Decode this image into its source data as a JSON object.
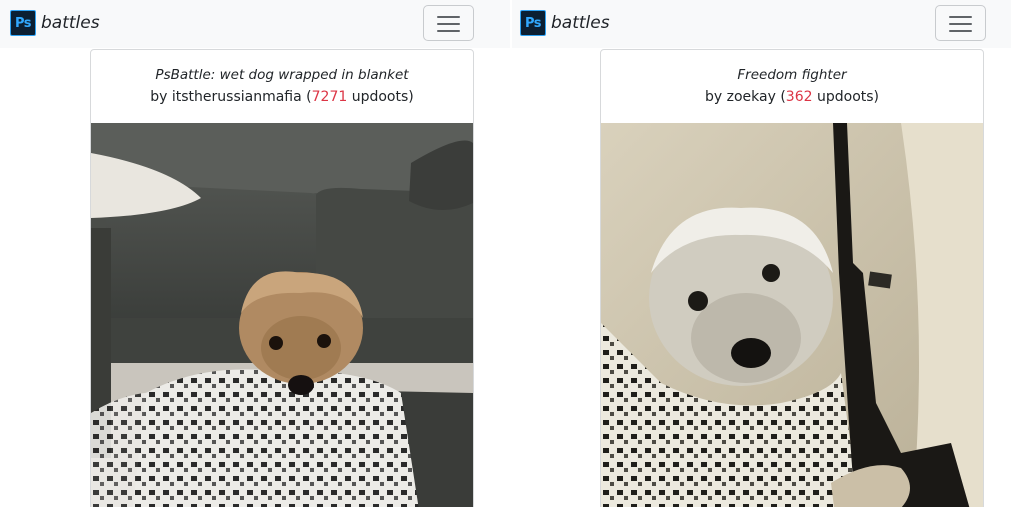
{
  "panes": [
    {
      "navbar": {
        "brand_logo_text": "Ps",
        "brand_name": "battles",
        "menu_icon": "hamburger-icon"
      },
      "post": {
        "title": "PsBattle: wet dog wrapped in blanket",
        "by_prefix": "by ",
        "author": "itstherussianmafia",
        "open_paren": " (",
        "score": "7271",
        "score_suffix": " updoots)",
        "image_icon": "dog-in-blanket-photo"
      }
    },
    {
      "navbar": {
        "brand_logo_text": "Ps",
        "brand_name": "battles",
        "menu_icon": "hamburger-icon"
      },
      "post": {
        "title": "Freedom fighter",
        "by_prefix": "by ",
        "author": "zoekay",
        "open_paren": " (",
        "score": "362",
        "score_suffix": " updoots)",
        "image_icon": "dog-with-rifle-photo"
      }
    }
  ],
  "colors": {
    "score": "#dc3545",
    "navbar_bg": "#f8f9fa",
    "logo_bg": "#0b1f33",
    "logo_accent": "#31a8ff"
  }
}
